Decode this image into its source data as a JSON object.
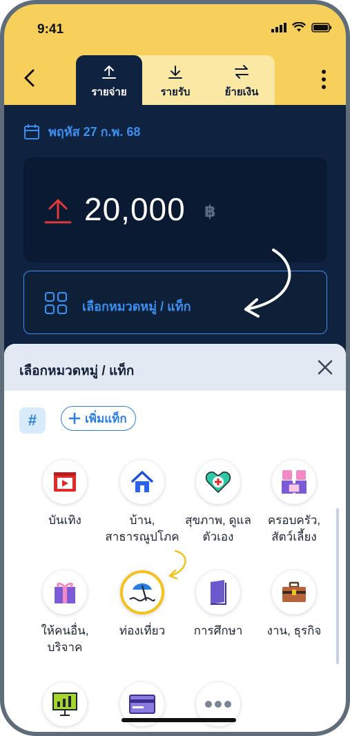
{
  "status": {
    "time": "9:41"
  },
  "tabs": [
    {
      "label": "รายจ่าย",
      "icon": "upload-icon",
      "active": true
    },
    {
      "label": "รายรับ",
      "icon": "download-icon",
      "active": false
    },
    {
      "label": "ย้ายเงิน",
      "icon": "transfer-icon",
      "active": false
    }
  ],
  "date": {
    "text": "พฤหัส 27 ก.พ. 68"
  },
  "amount": {
    "value": "20,000",
    "currency": "฿"
  },
  "category_field": {
    "label": "เลือกหมวดหมู่ / แท็ก"
  },
  "sheet": {
    "title": "เลือกหมวดหมู่ / แท็ก",
    "hash_label": "#",
    "add_tag_label": "เพิ่มแท็ก",
    "categories": [
      {
        "line1": "บันเทิง",
        "line2": "",
        "icon": "video-icon"
      },
      {
        "line1": "บ้าน,",
        "line2": "สาธารณูปโภค",
        "icon": "house-icon"
      },
      {
        "line1": "สุขภาพ, ดูแล",
        "line2": "ตัวเอง",
        "icon": "health-heart-icon"
      },
      {
        "line1": "ครอบครัว,",
        "line2": "สัตว์เลี้ยง",
        "icon": "family-pet-icon"
      },
      {
        "line1": "ให้คนอื่น,",
        "line2": "บริจาค",
        "icon": "gift-icon"
      },
      {
        "line1": "ท่องเที่ยว",
        "line2": "",
        "icon": "beach-umbrella-icon",
        "selected": true
      },
      {
        "line1": "การศึกษา",
        "line2": "",
        "icon": "book-icon"
      },
      {
        "line1": "งาน, ธุรกิจ",
        "line2": "",
        "icon": "briefcase-icon"
      }
    ]
  },
  "colors": {
    "yellow": "#f6d05a",
    "navy": "#0f2340",
    "blue": "#3b8ff0",
    "red": "#e5383b"
  }
}
